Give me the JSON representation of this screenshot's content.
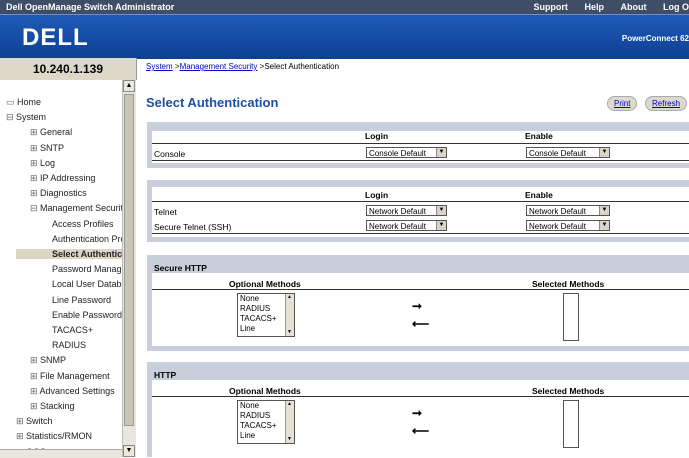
{
  "topbar": {
    "title": "Dell OpenManage Switch Administrator",
    "links": [
      "Support",
      "Help",
      "About",
      "Log O"
    ]
  },
  "banner": {
    "logo": "DELL",
    "product": "PowerConnect 62"
  },
  "sidebar": {
    "ip": "10.240.1.139",
    "items": [
      {
        "label": "Home",
        "icon": "home-icon"
      },
      {
        "label": "System",
        "icon": "minus-box-icon"
      },
      {
        "label": "General",
        "icon": "plus-box-icon"
      },
      {
        "label": "SNTP",
        "icon": "plus-box-icon"
      },
      {
        "label": "Log",
        "icon": "plus-box-icon"
      },
      {
        "label": "IP Addressing",
        "icon": "plus-box-icon"
      },
      {
        "label": "Diagnostics",
        "icon": "plus-box-icon"
      },
      {
        "label": "Management Securit",
        "icon": "minus-box-icon"
      },
      {
        "label": "Access Profiles",
        "icon": ""
      },
      {
        "label": "Authentication Pro",
        "icon": ""
      },
      {
        "label": "Select Authentic",
        "icon": "",
        "selected": true
      },
      {
        "label": "Password Manage",
        "icon": ""
      },
      {
        "label": "Local User Databa",
        "icon": ""
      },
      {
        "label": "Line Password",
        "icon": ""
      },
      {
        "label": "Enable Password",
        "icon": ""
      },
      {
        "label": "TACACS+",
        "icon": ""
      },
      {
        "label": "RADIUS",
        "icon": ""
      },
      {
        "label": "SNMP",
        "icon": "plus-box-icon"
      },
      {
        "label": "File Management",
        "icon": "plus-box-icon"
      },
      {
        "label": "Advanced Settings",
        "icon": "plus-box-icon"
      },
      {
        "label": "Stacking",
        "icon": "plus-box-icon"
      },
      {
        "label": "Switch",
        "icon": "plus-box-icon"
      },
      {
        "label": "Statistics/RMON",
        "icon": "plus-box-icon"
      },
      {
        "label": "QOS",
        "icon": "plus-box-icon"
      }
    ]
  },
  "breadcrumb": {
    "system": "System",
    "sep1": " >",
    "mgmt": "Management Security",
    "sep2": " >",
    "current": "Select Authentication"
  },
  "page": {
    "title": "Select Authentication",
    "print": "Print",
    "refresh": "Refresh"
  },
  "console": {
    "login_header": "Login",
    "enable_header": "Enable",
    "row_label": "Console",
    "login_value": "Console Default",
    "enable_value": "Console Default"
  },
  "telnet": {
    "login_header": "Login",
    "enable_header": "Enable",
    "rows": [
      {
        "label": "Telnet",
        "login": "Network Default",
        "enable": "Network Default"
      },
      {
        "label": "Secure Telnet (SSH)",
        "login": "Network Default",
        "enable": "Network Default"
      }
    ]
  },
  "secure_http": {
    "title": "Secure HTTP",
    "optional_header": "Optional Methods",
    "selected_header": "Selected Methods",
    "options": [
      "None",
      "RADIUS",
      "TACACS+",
      "Line"
    ]
  },
  "http": {
    "title": "HTTP",
    "optional_header": "Optional Methods",
    "selected_header": "Selected Methods",
    "options": [
      "None",
      "RADIUS",
      "TACACS+",
      "Line"
    ]
  }
}
